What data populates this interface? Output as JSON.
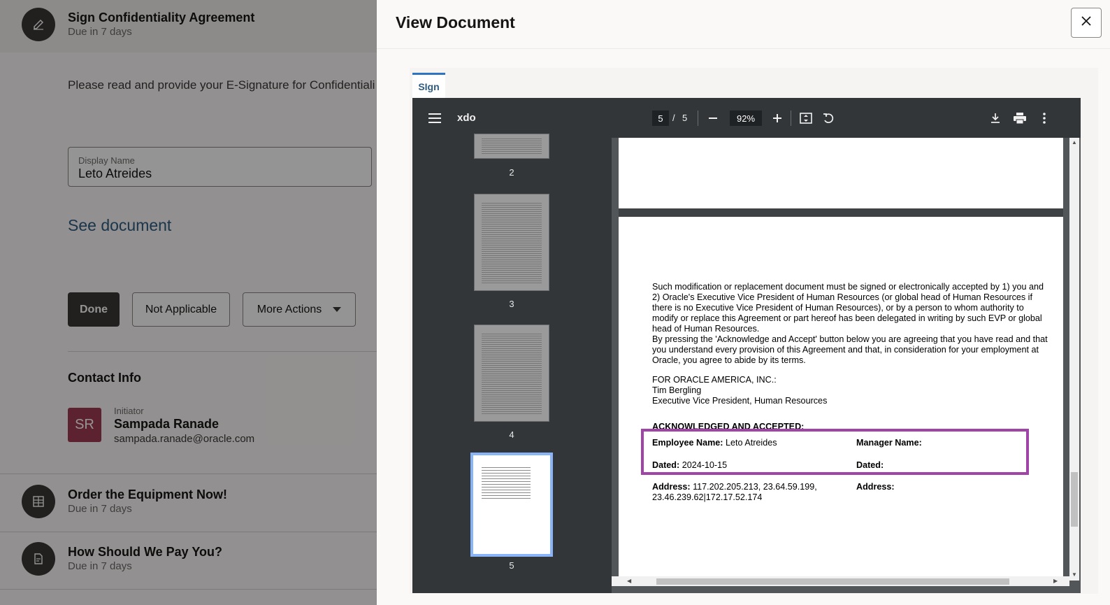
{
  "left_page": {
    "tasks": [
      {
        "title": "Sign Confidentiality Agreement",
        "due": "Due in 7 days",
        "icon": "pencil-icon"
      },
      {
        "title": "Order the Equipment Now!",
        "due": "Due in 7 days",
        "icon": "grid-icon"
      },
      {
        "title": "How Should We Pay You?",
        "due": "Due in 7 days",
        "icon": "form-icon"
      }
    ],
    "instructions": "Please read and provide your E-Signature for Confidentiali",
    "display_name_label": "Display Name",
    "display_name_value": "Leto Atreides",
    "see_document": "See document",
    "buttons": {
      "done": "Done",
      "not_applicable": "Not Applicable",
      "more_actions": "More Actions"
    },
    "contact": {
      "title": "Contact Info",
      "initials": "SR",
      "role": "Initiator",
      "name": "Sampada Ranade",
      "email": "sampada.ranade@oracle.com"
    }
  },
  "drawer": {
    "title": "View Document",
    "close_icon": "close-icon",
    "tab_label": "SIgn"
  },
  "viewer": {
    "doc_name": "xdo",
    "current_page": "5",
    "page_sep": "/",
    "total_pages": "5",
    "zoom": "92%",
    "thumb_labels": [
      "2",
      "3",
      "4",
      "5"
    ]
  },
  "pdf": {
    "para1": "Such modification or replacement document must be signed or electronically accepted by 1) you and 2) Oracle's Executive Vice President of Human Resources (or global head of Human Resources if there is no Executive Vice President of Human Resources), or by a person to whom authority to modify or replace this Agreement or part hereof has been delegated in writing by such EVP or global head of Human Resources.",
    "para2": "By pressing the 'Acknowledge and Accept' button below you are agreeing that you have read and that you understand every provision of this Agreement and that, in consideration for your employment at Oracle, you agree to abide by its terms.",
    "for_company": "FOR ORACLE AMERICA, INC.:",
    "signer_name": "Tim Bergling",
    "signer_title": "Executive Vice President, Human Resources",
    "ack_heading": "ACKNOWLEDGED AND ACCEPTED:",
    "employee_name_label": "Employee Name:",
    "employee_name_value": "Leto Atreides",
    "manager_name_label": "Manager Name:",
    "dated_label": "Dated:",
    "dated_value": "2024-10-15",
    "manager_dated_label": "Dated:",
    "address_label": "Address:",
    "address_value": "117.202.205.213, 23.64.59.199, 23.46.239.62|172.17.52.174",
    "manager_address_label": "Address:"
  },
  "colors": {
    "highlight": "#a044a8",
    "link": "#2f5c80",
    "dark_button": "#3b3836",
    "avatar": "#a13b52",
    "selected_thumb": "#8ab4f8"
  }
}
